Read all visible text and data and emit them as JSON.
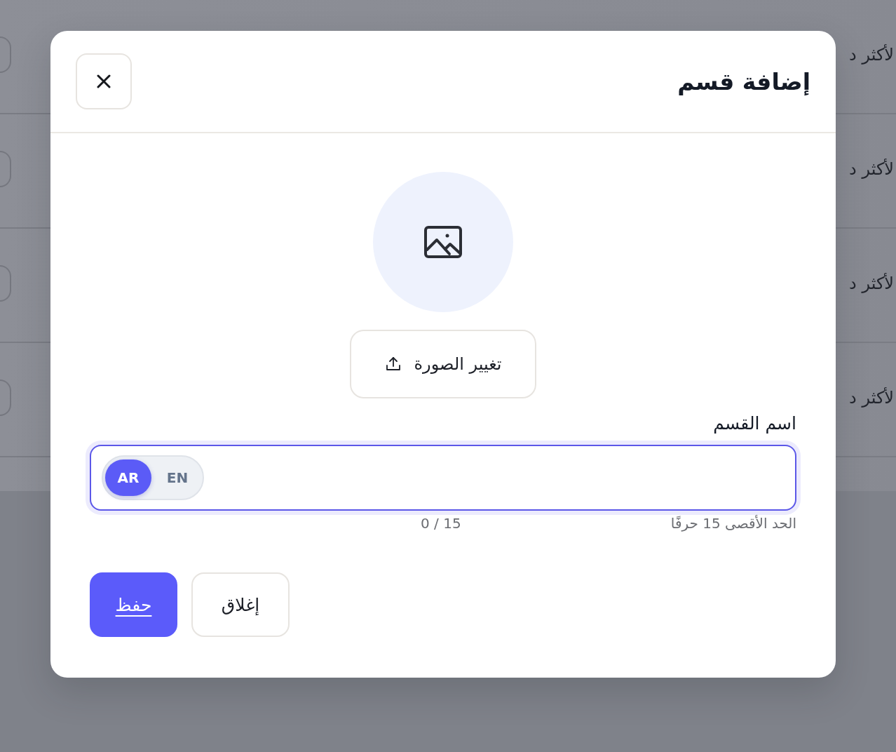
{
  "background": {
    "rows": [
      {
        "text": "لأكثر د"
      },
      {
        "text": "لأكثر د"
      },
      {
        "text": "لأكثر د"
      },
      {
        "text": "لأكثر د"
      }
    ]
  },
  "dialog": {
    "title": "إضافة قسم",
    "change_image_button": {
      "label": "تغيير الصورة"
    },
    "name_field": {
      "label": "اسم القسم",
      "focused": true,
      "languages": [
        {
          "label": "EN",
          "selected": false
        },
        {
          "label": "AR",
          "selected": true
        }
      ],
      "hint": "الحد الأقصى 15 حرفًا",
      "counter": "0 / 15"
    },
    "buttons": [
      {
        "label": "إغلاق",
        "kind": "secondary"
      },
      {
        "label": "حفظ",
        "kind": "primary"
      }
    ]
  }
}
